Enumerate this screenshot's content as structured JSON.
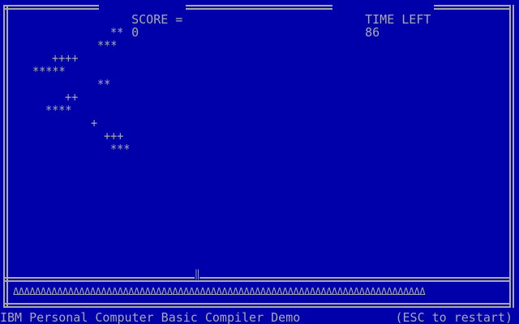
{
  "hud": {
    "score_label": "SCORE =",
    "score_value": "0",
    "time_label": "TIME LEFT",
    "time_value": "86"
  },
  "field": {
    "rows": [
      {
        "text": "**"
      },
      {
        "text": "***"
      },
      {
        "text": "++++"
      },
      {
        "text": "*****"
      },
      {
        "text": "**"
      },
      {
        "text": "++"
      },
      {
        "text": "****"
      },
      {
        "text": "+"
      },
      {
        "text": "+++"
      },
      {
        "text": "***"
      }
    ],
    "player": "‖",
    "ground_glyph": "Δ",
    "ground_count": 75
  },
  "status": {
    "left": "IBM Personal Computer Basic Compiler Demo",
    "right": "(ESC to restart)"
  },
  "colors": {
    "background": "#0000aa",
    "foreground": "#aaaaaa"
  }
}
